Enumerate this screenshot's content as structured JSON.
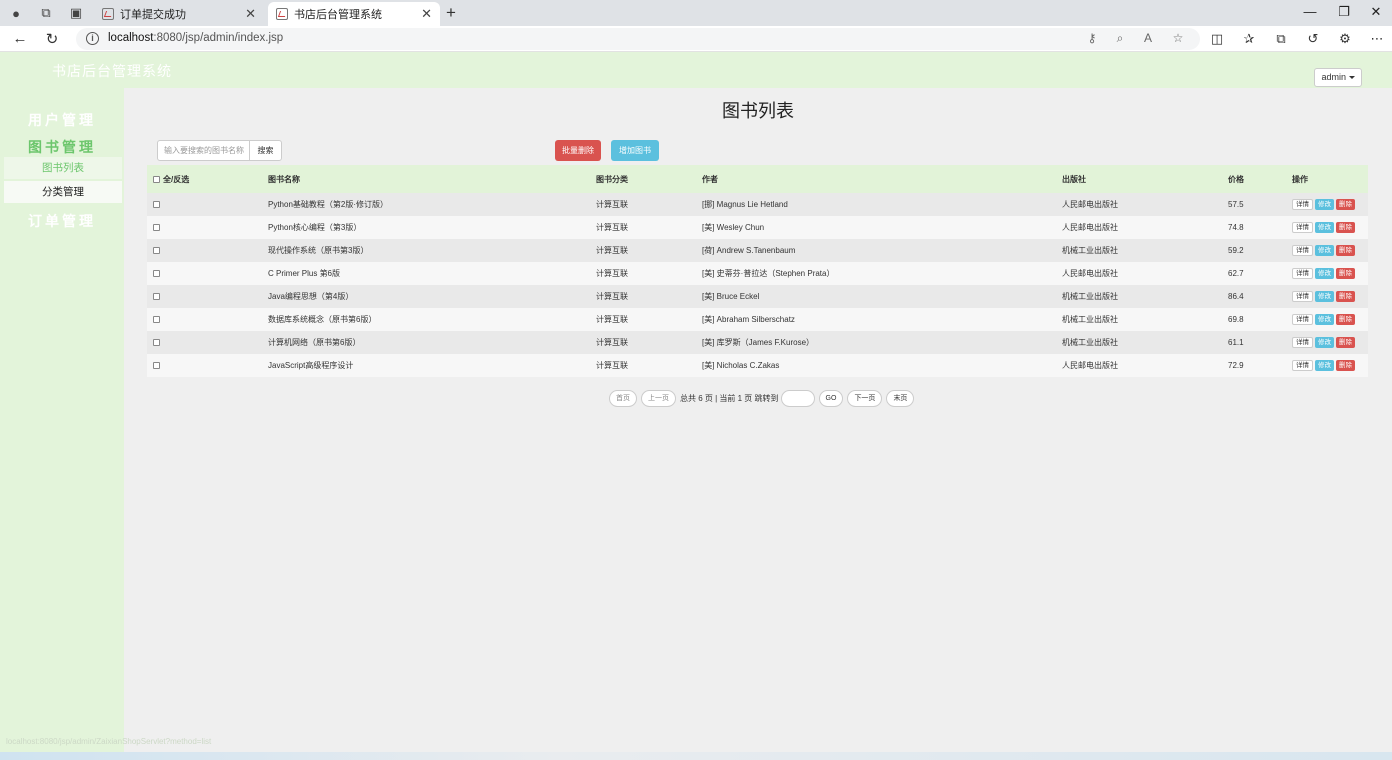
{
  "browser": {
    "tabs": [
      {
        "title": "订单提交成功",
        "active": false
      },
      {
        "title": "书店后台管理系统",
        "active": true
      }
    ],
    "url_host": "localhost",
    "url_rest": ":8080/jsp/admin/index.jsp"
  },
  "app": {
    "brand": "书店后台管理系统",
    "user_menu": "admin"
  },
  "sidebar": {
    "groups": [
      {
        "label": "用户管理"
      },
      {
        "label": "图书管理",
        "items": [
          {
            "label": "图书列表"
          },
          {
            "label": "分类管理"
          }
        ]
      },
      {
        "label": "订单管理"
      }
    ]
  },
  "main": {
    "title": "图书列表",
    "search_placeholder": "输入要搜索的图书名称",
    "search_button": "搜索",
    "batch_delete_button": "批量删除",
    "add_button": "增加图书"
  },
  "table": {
    "headers": [
      "全/反选",
      "图书名称",
      "图书分类",
      "作者",
      "出版社",
      "价格",
      "操作"
    ],
    "action_labels": [
      "详情",
      "修改",
      "删除"
    ],
    "rows": [
      {
        "name": "Python基础教程（第2版·修订版）",
        "category": "计算互联",
        "author": "[挪] Magnus Lie Hetland",
        "publisher": "人民邮电出版社",
        "price": "57.5"
      },
      {
        "name": "Python核心编程（第3版）",
        "category": "计算互联",
        "author": "[美] Wesley Chun",
        "publisher": "人民邮电出版社",
        "price": "74.8"
      },
      {
        "name": "现代操作系统（原书第3版）",
        "category": "计算互联",
        "author": "[荷] Andrew S.Tanenbaum",
        "publisher": "机械工业出版社",
        "price": "59.2"
      },
      {
        "name": "C Primer Plus 第6版",
        "category": "计算互联",
        "author": "[美] 史蒂芬·普拉达（Stephen Prata）",
        "publisher": "人民邮电出版社",
        "price": "62.7"
      },
      {
        "name": "Java编程思想（第4版）",
        "category": "计算互联",
        "author": "[美] Bruce Eckel",
        "publisher": "机械工业出版社",
        "price": "86.4"
      },
      {
        "name": "数据库系统概念（原书第6版）",
        "category": "计算互联",
        "author": "[美] Abraham Silberschatz",
        "publisher": "机械工业出版社",
        "price": "69.8"
      },
      {
        "name": "计算机网络（原书第6版）",
        "category": "计算互联",
        "author": "[美] 库罗斯（James F.Kurose）",
        "publisher": "机械工业出版社",
        "price": "61.1"
      },
      {
        "name": "JavaScript高级程序设计",
        "category": "计算互联",
        "author": "[美] Nicholas C.Zakas",
        "publisher": "人民邮电出版社",
        "price": "72.9"
      }
    ]
  },
  "pager": {
    "first": "首页",
    "prev": "上一页",
    "summary": "总共 6 页 | 当前 1 页 跳转到",
    "go": "GO",
    "next": "下一页",
    "last": "末页"
  },
  "status_url": "localhost:8080/jsp/admin/ZaixianShopServlet?method=list",
  "colors": {
    "sidebar_bg": "#e3f4da",
    "accent_green": "#6cc66c",
    "danger": "#d9534f",
    "info": "#5bc0de"
  }
}
